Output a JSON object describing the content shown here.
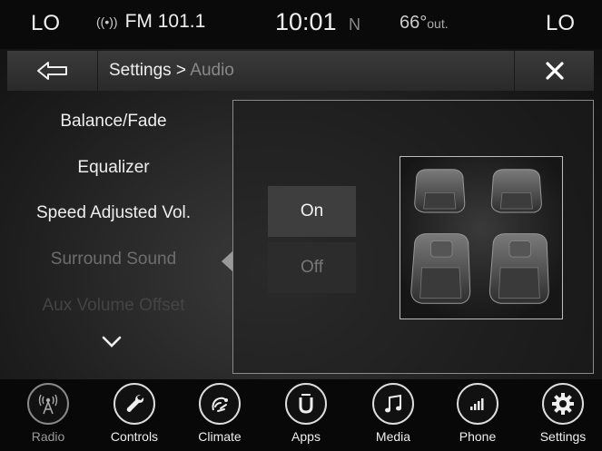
{
  "status": {
    "left_audio": "LO",
    "right_audio": "LO",
    "band": "FM 101.1",
    "time": "10:01",
    "compass": "N",
    "temp_value": "66°",
    "temp_unit": "out."
  },
  "header": {
    "breadcrumb_main": "Settings >",
    "breadcrumb_sub": "Audio"
  },
  "menu": {
    "items": [
      {
        "label": "Balance/Fade"
      },
      {
        "label": "Equalizer"
      },
      {
        "label": "Speed Adjusted Vol."
      },
      {
        "label": "Surround Sound"
      },
      {
        "label": "Aux Volume Offset"
      }
    ]
  },
  "surround": {
    "on_label": "On",
    "off_label": "Off",
    "selected": "On"
  },
  "nav": {
    "items": [
      {
        "label": "Radio",
        "icon": "radio-icon"
      },
      {
        "label": "Controls",
        "icon": "wrench-icon"
      },
      {
        "label": "Climate",
        "icon": "climate-icon"
      },
      {
        "label": "Apps",
        "icon": "apps-icon"
      },
      {
        "label": "Media",
        "icon": "music-note-icon"
      },
      {
        "label": "Phone",
        "icon": "phone-signal-icon"
      },
      {
        "label": "Settings",
        "icon": "gear-icon"
      }
    ]
  }
}
